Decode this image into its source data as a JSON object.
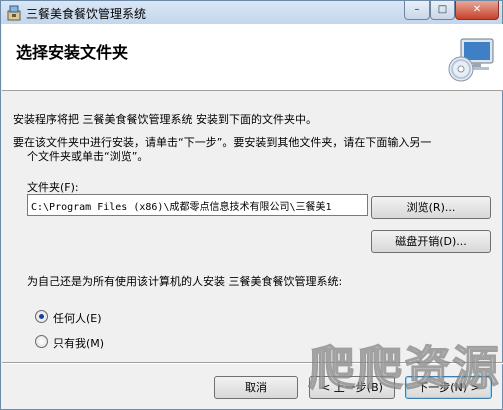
{
  "window": {
    "title": "三餐美食餐饮管理系统",
    "minimize_glyph": "–",
    "maximize_glyph": "□",
    "close_glyph": "✕"
  },
  "header": {
    "title": "选择安装文件夹",
    "icon": "computer-cd-icon"
  },
  "body": {
    "intro": "安装程序将把 三餐美食餐饮管理系统 安装到下面的文件夹中。",
    "instruction_line1": "要在该文件夹中进行安装，请单击“下一步”。要安装到其他文件夹，请在下面输入另一",
    "instruction_line2": "个文件夹或单击“浏览”。",
    "folder_label": "文件夹(F):",
    "folder_value": "C:\\Program Files (x86)\\成都零点信息技术有限公司\\三餐美1",
    "browse_button": "浏览(R)...",
    "disk_cost_button": "磁盘开销(D)...",
    "install_for_question": "为自己还是为所有使用该计算机的人安装 三餐美食餐饮管理系统:",
    "radio_everyone": "任何人(E)",
    "radio_only_me": "只有我(M)",
    "selected": "everyone"
  },
  "footer": {
    "cancel_button": "取消",
    "back_button": "< 上一步(B)",
    "next_button": "下一步(N) >"
  },
  "watermark": {
    "text": "爬爬资源"
  },
  "colors": {
    "titlebar": "#c3d6ec",
    "close_button": "#c7412b",
    "dialog_bg": "#f0f0f0",
    "radio_dot": "#1b3fa6"
  }
}
